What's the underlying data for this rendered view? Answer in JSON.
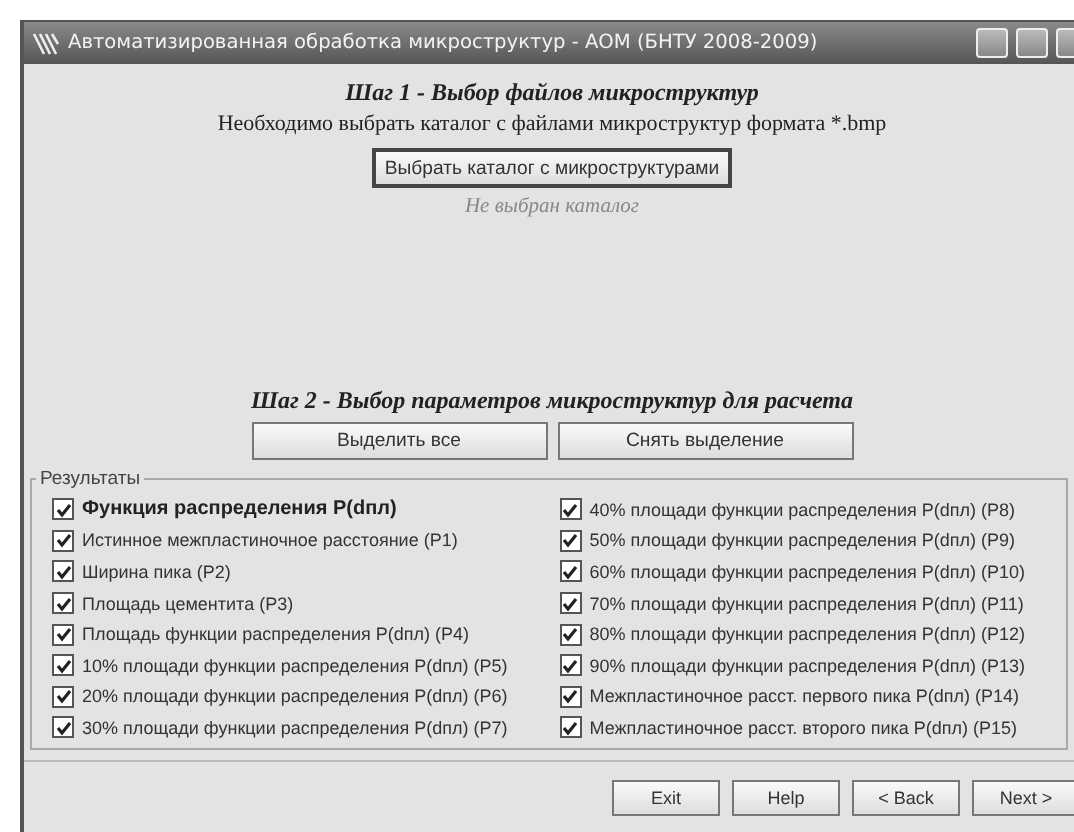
{
  "window": {
    "title": "Автоматизированная обработка микроструктур - АОМ (БНТУ 2008-2009)"
  },
  "step1": {
    "title": "Шаг 1 - Выбор файлов микроструктур",
    "instruction": "Необходимо выбрать каталог с файлами микроструктур формата *.bmp",
    "button": "Выбрать каталог с микроструктурами",
    "status": "Не выбран каталог"
  },
  "step2": {
    "title": "Шаг 2 - Выбор параметров микроструктур для расчета",
    "buttons": [
      "Выделить все",
      "Снять выделение"
    ]
  },
  "results": {
    "label": "Результаты",
    "columns": [
      [
        {
          "label": "Функция распределения P(dпл)",
          "kind": "main",
          "checked": true
        },
        {
          "label": "Истинное межпластиночное расстояние (P1)",
          "kind": "param",
          "checked": true
        },
        {
          "label": "Ширина пика (P2)",
          "kind": "param",
          "checked": true
        },
        {
          "label": "Площадь цементита (P3)",
          "kind": "param",
          "checked": true
        },
        {
          "label": "Площадь функции распределения P(dпл) (P4)",
          "kind": "param",
          "checked": true
        },
        {
          "label": "10% площади функции распределения P(dпл) (P5)",
          "kind": "param",
          "checked": true
        },
        {
          "label": "20% площади функции распределения P(dпл) (P6)",
          "kind": "param",
          "checked": true
        },
        {
          "label": "30% площади функции распределения P(dпл) (P7)",
          "kind": "param",
          "checked": true
        }
      ],
      [
        {
          "label": "40% площади функции распределения P(dпл) (P8)",
          "kind": "param",
          "checked": true
        },
        {
          "label": "50% площади функции распределения P(dпл) (P9)",
          "kind": "param",
          "checked": true
        },
        {
          "label": "60% площади функции распределения P(dпл) (P10)",
          "kind": "param",
          "checked": true
        },
        {
          "label": "70% площади функции распределения P(dпл) (P11)",
          "kind": "param",
          "checked": true
        },
        {
          "label": "80% площади функции распределения P(dпл) (P12)",
          "kind": "param",
          "checked": true
        },
        {
          "label": "90% площади функции распределения P(dпл) (P13)",
          "kind": "param",
          "checked": true
        },
        {
          "label": "Межпластиночное расст. первого пика P(dпл) (P14)",
          "kind": "param",
          "checked": true
        },
        {
          "label": "Межпластиночное расст. второго пика P(dпл) (P15)",
          "kind": "param",
          "checked": true
        }
      ]
    ]
  },
  "footer": {
    "buttons": [
      "Exit",
      "Help",
      "< Back",
      "Next >"
    ]
  }
}
